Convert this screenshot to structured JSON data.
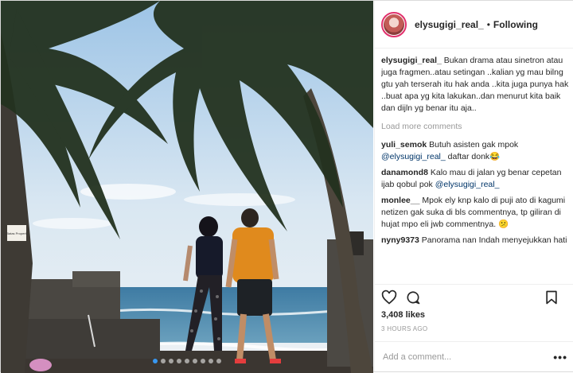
{
  "post": {
    "username": "elysugigi_real_",
    "separator": "•",
    "follow_status": "Following",
    "caption": {
      "username": "elysugigi_real_",
      "text": " Bukan drama atau sinetron atau juga fragmen..atau setingan ..kalian yg mau bilng gtu yah terserah itu hak anda ..kita juga punya hak ..buat apa yg kita lakukan..dan menurut kita baik dan dijln yg benar itu aja.."
    },
    "load_more": "Load more comments",
    "comments": [
      {
        "username": "yuli_semok",
        "before": " Butuh asisten gak mpok ",
        "mention": "@elysugigi_real_",
        "after": " daftar donk😂"
      },
      {
        "username": "danamond8",
        "before": " Kalo mau di jalan yg benar cepetan ijab qobul pok ",
        "mention": "@elysugigi_real_",
        "after": ""
      },
      {
        "username": "monlee__",
        "before": " Mpok ely knp kalo di puji ato di kagumi netizen gak suka di bls commentnya, tp giliran di hujat mpo eli jwb commentnya. 😕",
        "mention": "",
        "after": ""
      },
      {
        "username": "nyny9373",
        "before": " Panorama nan Indah menyejukkan hati",
        "mention": "",
        "after": ""
      }
    ],
    "likes": "3,408 likes",
    "time": "3 HOURS AGO",
    "add_comment_placeholder": "Add a comment...",
    "more_label": "•••",
    "sign_text": "Batas Properti"
  },
  "icons": {
    "like": "heart-icon",
    "comment": "comment-icon",
    "save": "bookmark-icon",
    "more": "more-options-icon"
  },
  "colors": {
    "mention": "#003569",
    "muted": "#999999",
    "carousel_active": "#3897f0",
    "story_ring": "#e1306c"
  }
}
